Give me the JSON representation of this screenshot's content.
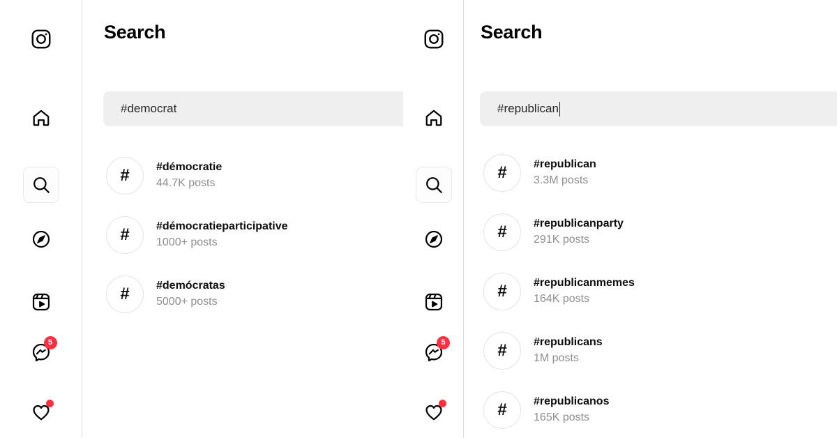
{
  "panels": [
    {
      "id": "left",
      "page_title": "Search",
      "search": {
        "value": "#democrat",
        "placeholder": "Search",
        "caret_visible": false
      },
      "nav": {
        "logo": "instagram-logo-icon",
        "items": [
          {
            "name": "home",
            "icon": "home-icon",
            "active": false,
            "badge": null
          },
          {
            "name": "search",
            "icon": "search-icon",
            "active": true,
            "badge": null
          },
          {
            "name": "explore",
            "icon": "compass-icon",
            "active": false,
            "badge": null
          },
          {
            "name": "reels",
            "icon": "reels-icon",
            "active": false,
            "badge": null
          },
          {
            "name": "messages",
            "icon": "messenger-icon",
            "active": false,
            "badge": "5"
          },
          {
            "name": "notifications",
            "icon": "heart-icon",
            "active": false,
            "badge": "dot"
          }
        ]
      },
      "results": [
        {
          "icon": "hashtag-icon",
          "name": "#démocratie",
          "count": "44.7K posts"
        },
        {
          "icon": "hashtag-icon",
          "name": "#démocratieparticipative",
          "count": "1000+ posts"
        },
        {
          "icon": "hashtag-icon",
          "name": "#demócratas",
          "count": "5000+ posts"
        }
      ]
    },
    {
      "id": "right",
      "page_title": "Search",
      "search": {
        "value": "#republican",
        "placeholder": "Search",
        "caret_visible": true
      },
      "nav": {
        "logo": "instagram-logo-icon",
        "items": [
          {
            "name": "home",
            "icon": "home-icon",
            "active": false,
            "badge": null
          },
          {
            "name": "search",
            "icon": "search-icon",
            "active": true,
            "badge": null
          },
          {
            "name": "explore",
            "icon": "compass-icon",
            "active": false,
            "badge": null
          },
          {
            "name": "reels",
            "icon": "reels-icon",
            "active": false,
            "badge": null
          },
          {
            "name": "messages",
            "icon": "messenger-icon",
            "active": false,
            "badge": "5"
          },
          {
            "name": "notifications",
            "icon": "heart-icon",
            "active": false,
            "badge": "dot"
          }
        ]
      },
      "results": [
        {
          "icon": "hashtag-icon",
          "name": "#republican",
          "count": "3.3M posts"
        },
        {
          "icon": "hashtag-icon",
          "name": "#republicanparty",
          "count": "291K posts"
        },
        {
          "icon": "hashtag-icon",
          "name": "#republicanmemes",
          "count": "164K posts"
        },
        {
          "icon": "hashtag-icon",
          "name": "#republicans",
          "count": "1M posts"
        },
        {
          "icon": "hashtag-icon",
          "name": "#republicanos",
          "count": "165K posts"
        }
      ]
    }
  ],
  "colors": {
    "accent_badge": "#ff3040",
    "search_field_bg": "#efefef",
    "primary_text": "#0d0d0d",
    "secondary_text": "#8e8e8e",
    "divider": "#dbdbdb"
  },
  "hash_glyph": "#"
}
